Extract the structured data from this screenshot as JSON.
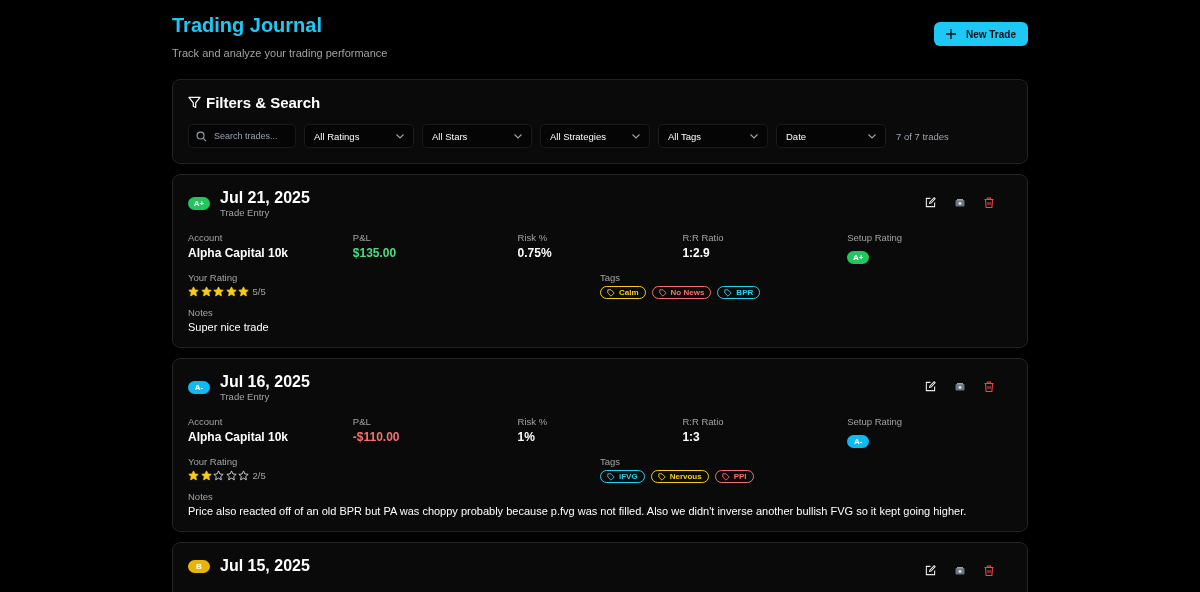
{
  "header": {
    "title": "Trading Journal",
    "subtitle": "Track and analyze your trading performance",
    "new_button": "New Trade"
  },
  "filters": {
    "title": "Filters & Search",
    "search": {
      "placeholder": "Search trades..."
    },
    "dropdowns": [
      "All Ratings",
      "All Stars",
      "All Strategies",
      "All Tags",
      "Date"
    ],
    "count": "7 of 7 trades"
  },
  "trades": [
    {
      "rating": "A+",
      "color": "#22c55e",
      "date": "Jul 21, 2025",
      "subtitle": "Trade Entry",
      "account_label": "Account",
      "account": "Alpha Capital 10k",
      "pnl_label": "P&L",
      "pnl": "$135.00",
      "kind": "profit",
      "risk_label": "Risk %",
      "risk": "0.75%",
      "rr_label": "R:R Ratio",
      "rr": "1:2.9",
      "setup_label": "Setup Rating",
      "setup_rating": "A+",
      "your_rating_label": "Your Rating",
      "stars": 5,
      "stars_text": "5/5",
      "tags_label": "Tags",
      "tags": [
        {
          "label": "Calm",
          "color": "#facc15"
        },
        {
          "label": "No News",
          "color": "#f87171"
        },
        {
          "label": "BPR",
          "color": "#22d3ee"
        }
      ],
      "notes_label": "Notes",
      "notes": "Super nice trade"
    },
    {
      "rating": "A-",
      "color": "#0ebbf0",
      "date": "Jul 16, 2025",
      "subtitle": "Trade Entry",
      "account_label": "Account",
      "account": "Alpha Capital 10k",
      "pnl_label": "P&L",
      "pnl": "-$110.00",
      "kind": "loss",
      "risk_label": "Risk %",
      "risk": "1%",
      "rr_label": "R:R Ratio",
      "rr": "1:3",
      "setup_label": "Setup Rating",
      "setup_rating": "A-",
      "your_rating_label": "Your Rating",
      "stars": 2,
      "stars_text": "2/5",
      "tags_label": "Tags",
      "tags": [
        {
          "label": "iFVG",
          "color": "#22d3ee"
        },
        {
          "label": "Nervous",
          "color": "#facc15"
        },
        {
          "label": "PPI",
          "color": "#f87171"
        }
      ],
      "notes_label": "Notes",
      "notes": "Price also reacted off of an old BPR but PA was choppy probably because p.fvg was not filled. Also we didn't inverse another bullish FVG so it kept going higher."
    },
    {
      "rating": "B",
      "color": "#eab308",
      "date": "Jul 15, 2025"
    }
  ]
}
